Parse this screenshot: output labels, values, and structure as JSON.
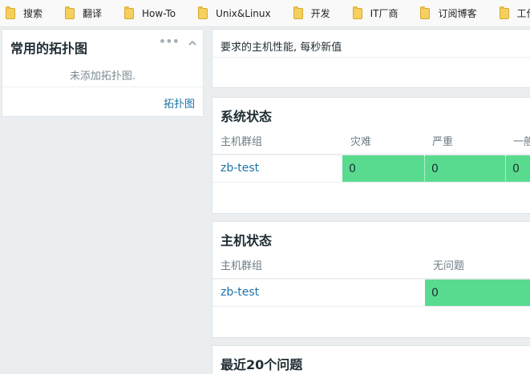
{
  "bookmarks": [
    {
      "label": "搜索"
    },
    {
      "label": "翻译"
    },
    {
      "label": "How-To"
    },
    {
      "label": "Unix&Linux"
    },
    {
      "label": "开发"
    },
    {
      "label": "IT厂商"
    },
    {
      "label": "订阅博客"
    },
    {
      "label": "工作、生活"
    }
  ],
  "fav_maps": {
    "title": "常用的拓扑图",
    "empty_message": "未添加拓扑图.",
    "footer_link": "拓扑图"
  },
  "performance": {
    "text": "要求的主机性能, 每秒新值"
  },
  "system_status": {
    "title": "系统状态",
    "headers": [
      "主机群组",
      "灾难",
      "严重",
      "一般"
    ],
    "rows": [
      {
        "group": "zb-test",
        "disaster": "0",
        "high": "0",
        "average": "0"
      }
    ]
  },
  "host_status": {
    "title": "主机状态",
    "headers": [
      "主机群组",
      "无问题"
    ],
    "rows": [
      {
        "group": "zb-test",
        "no_problem": "0"
      }
    ]
  },
  "last_problems": {
    "title": "最近20个问题"
  },
  "colors": {
    "ok_green": "#59db8f",
    "link_blue": "#1a74a8",
    "background": "#ebeef0"
  }
}
